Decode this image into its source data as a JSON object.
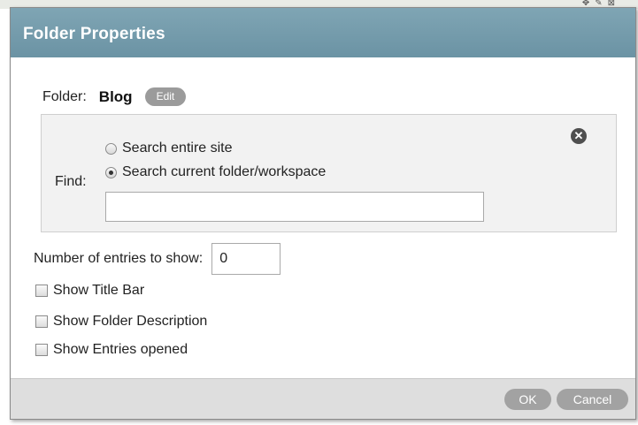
{
  "dialog": {
    "title": "Folder Properties"
  },
  "folder": {
    "label": "Folder:",
    "name": "Blog",
    "edit_label": "Edit"
  },
  "find": {
    "label": "Find:",
    "options": [
      {
        "label": "Search entire site",
        "checked": false
      },
      {
        "label": "Search current folder/workspace",
        "checked": true
      }
    ],
    "value": ""
  },
  "entries": {
    "label": "Number of entries to show:",
    "value": "0"
  },
  "checkboxes": [
    {
      "label": "Show Title Bar",
      "checked": false
    },
    {
      "label": "Show Folder Description",
      "checked": false
    },
    {
      "label": "Show Entries opened",
      "checked": false
    }
  ],
  "footer": {
    "ok_label": "OK",
    "cancel_label": "Cancel"
  },
  "colors": {
    "titlebar": "#7299aa",
    "button": "#a2a2a2"
  }
}
